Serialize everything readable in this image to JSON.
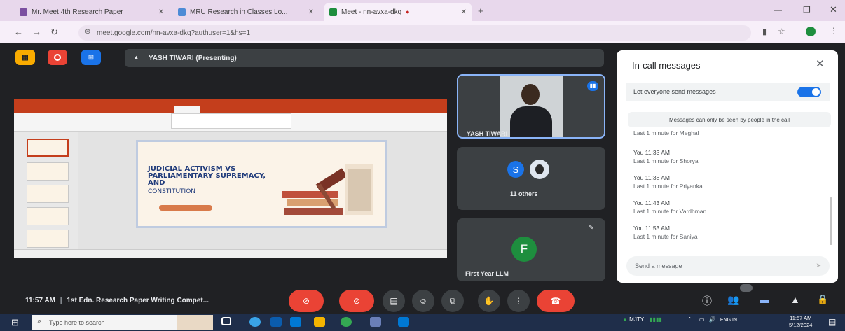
{
  "browser": {
    "tabs": [
      {
        "label": "Mr. Meet 4th Research Paper",
        "color": "#7b4fa0"
      },
      {
        "label": "MRU Research in Classes Lo...",
        "color": "#4d8bd6"
      },
      {
        "label": "Meet - nn-avxa-dkq",
        "color": "#1e8e3e"
      }
    ],
    "url": "meet.google.com/nn-avxa-dkq?authuser=1&hs=1"
  },
  "meet": {
    "presenter_label": "YASH TIWARI (Presenting)",
    "slide": {
      "title": "JUDICIAL ACTIVISM VS PARLIAMENTARY SUPREMACY, AND",
      "subtitle": "CONSTITUTION"
    },
    "tiles": {
      "presenter_name": "YASH TIWARI",
      "others_avatar": "S",
      "others_label": "11 others",
      "self_avatar": "F",
      "self_name": "First Year LLM"
    },
    "meeting_time": "11:57 AM",
    "meeting_title": "1st Edn. Research Paper Writing Compet..."
  },
  "chat": {
    "title": "In-call messages",
    "permission_label": "Let everyone send messages",
    "permission_on": true,
    "notice": "Messages can only be seen by people in the call",
    "messages": [
      {
        "sender": "",
        "time": "",
        "text": "Last 1 minute for Meghal"
      },
      {
        "sender": "You",
        "time": "11:33 AM",
        "text": "Last 1 minute for Shorya"
      },
      {
        "sender": "You",
        "time": "11:38 AM",
        "text": "Last 1 minute for Priyanka"
      },
      {
        "sender": "You",
        "time": "11:43 AM",
        "text": "Last 1 minute for Vardhman"
      },
      {
        "sender": "You",
        "time": "11:53 AM",
        "text": "Last 1 minute for Saniya"
      }
    ],
    "input_placeholder": "Send a message",
    "send_label": "Send"
  },
  "taskbar": {
    "search_placeholder": "Type here to search",
    "system_text": "MJTY",
    "language": "ENG",
    "lang_region": "IN",
    "time": "11:57 AM",
    "date": "5/12/2024"
  },
  "colors": {
    "meet_bg": "#202124",
    "tile_bg": "#3c4043",
    "end_call": "#ea4335",
    "accent": "#1a73e8"
  }
}
